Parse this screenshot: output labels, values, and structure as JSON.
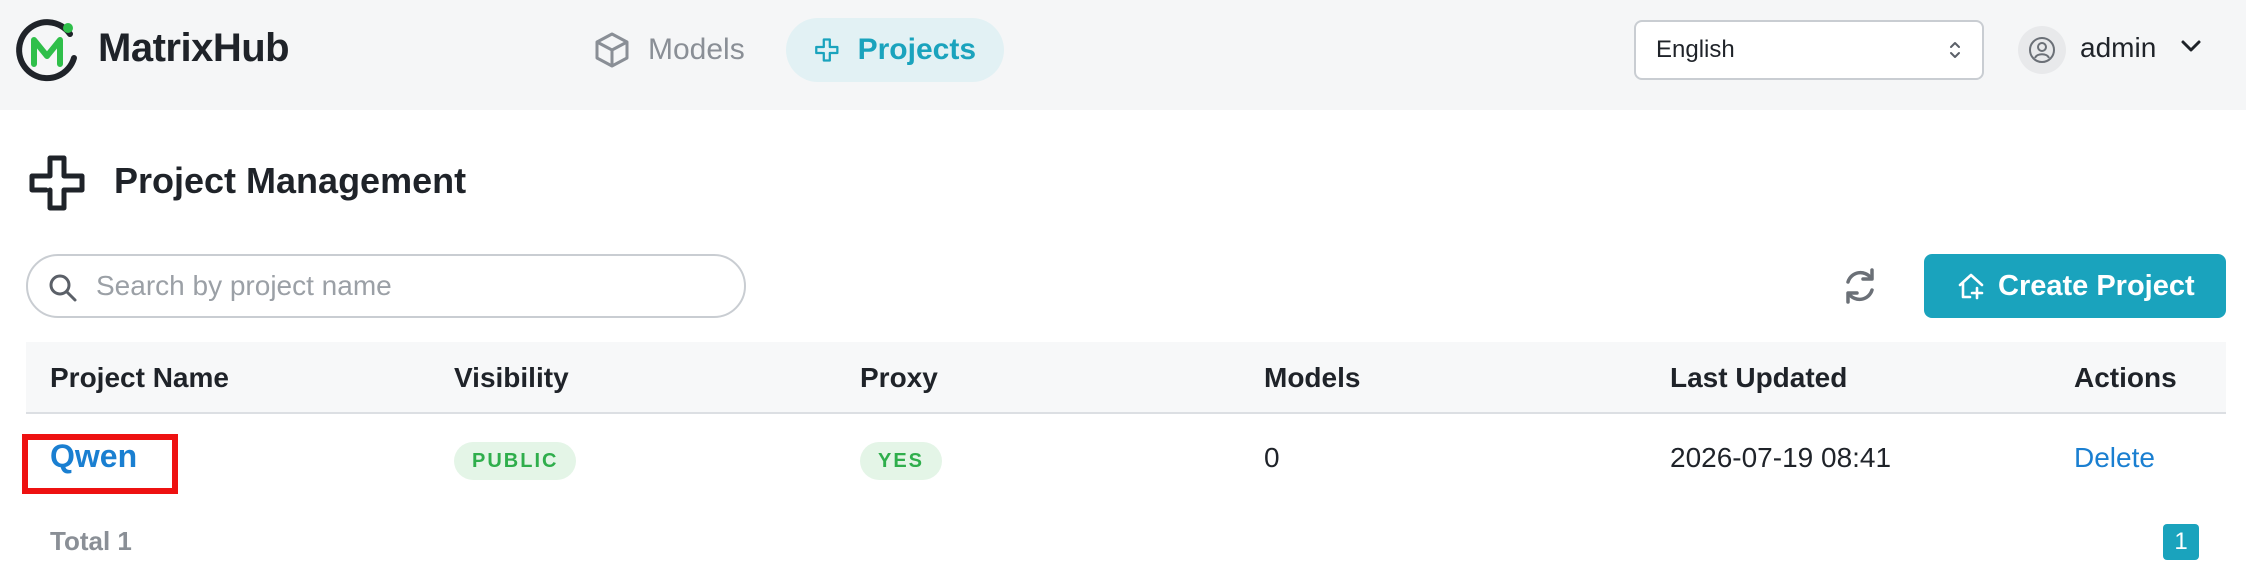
{
  "app": {
    "brand": "MatrixHub",
    "accent_color": "#1aa3bd",
    "logo_colors": [
      "#1f2329",
      "#2fbf4a"
    ]
  },
  "nav": {
    "items": [
      {
        "label": "Models",
        "icon": "cube-icon",
        "active": false
      },
      {
        "label": "Projects",
        "icon": "project-icon",
        "active": true
      }
    ]
  },
  "language": {
    "selected": "English"
  },
  "user": {
    "name": "admin"
  },
  "page": {
    "title": "Project Management",
    "icon": "project-icon"
  },
  "search": {
    "placeholder": "Search by project name",
    "value": ""
  },
  "toolbar": {
    "create_label": "Create Project",
    "refresh_icon": "refresh-icon"
  },
  "table": {
    "columns": [
      "Project Name",
      "Visibility",
      "Proxy",
      "Models",
      "Last Updated",
      "Actions"
    ],
    "rows": [
      {
        "name": "Qwen",
        "visibility": "PUBLIC",
        "proxy": "YES",
        "models": "0",
        "last_updated": "2026-07-19 08:41",
        "action": "Delete"
      }
    ]
  },
  "pagination": {
    "total": "Total 1",
    "current_page": "1"
  }
}
